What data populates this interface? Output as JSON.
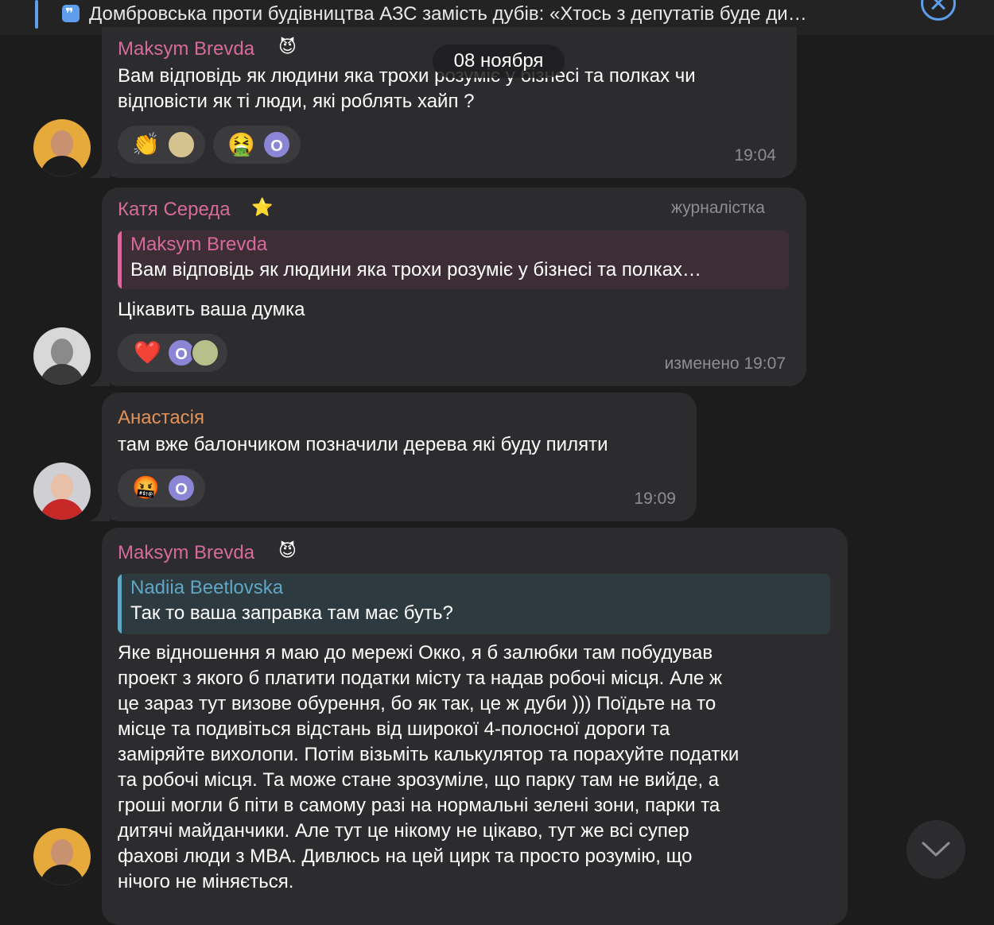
{
  "pinned": {
    "text": "Домбровська проти будівництва АЗС замість дубів: «Хтось з депутатів буде ди…"
  },
  "date_separator": "08 ноября",
  "messages": [
    {
      "sender": "Maksym Brevda",
      "sender_badge": "😈",
      "text_lines": [
        "Вам відповідь як людини яка трохи розуміє у бізнесі та полках чи",
        "відповісти як ті люди, які роблять хайп ?"
      ],
      "reactions": [
        "👏",
        "🤮"
      ],
      "reaction_initial": "О",
      "time": "19:04"
    },
    {
      "sender": "Катя Середа",
      "sender_badge": "⭐",
      "role": "журналістка",
      "reply_to": {
        "name": "Maksym Brevda",
        "text": "Вам відповідь як людини яка трохи розуміє у бізнесі та полках…"
      },
      "text": "Цікавить ваша думка",
      "reactions": [
        "❤️"
      ],
      "reaction_initial": "О",
      "time": "изменено 19:07"
    },
    {
      "sender": "Анастасія",
      "text": "там вже балончиком позначили дерева які буду пиляти",
      "reactions": [
        "🤬"
      ],
      "reaction_initial": "О",
      "time": "19:09"
    },
    {
      "sender": "Maksym Brevda",
      "sender_badge": "😈",
      "reply_to": {
        "name": "Nadiia Beetlovska",
        "text": "Так то ваша заправка там має буть?"
      },
      "text_lines": [
        "Яке відношення я маю до мережі Окко, я б залюбки там побудував",
        "проект з якого б платити податки місту та надав робочі місця. Але ж",
        "це зараз тут визове обурення, бо як так, це ж дуби ))) Поїдьте на то",
        "місце та подивіться відстань від широкої 4-полосної дороги та",
        "заміряйте вихолопи. Потім візьміть калькулятор та порахуйте податки",
        "та робочі місця. Та може стане зрозуміле, що парку там не вийде, а",
        "гроші могли б піти в самому разі на нормальні зелені зони, парки та",
        "дитячі майданчики. Але тут це нікому не цікаво, тут же всі супер",
        "фахові люди з MBA. Дивлюсь на цей цирк та просто розумію, що",
        "нічого не міняється."
      ]
    }
  ],
  "colors": {
    "background": "#1c1c1d",
    "bubble": "#2c2c2e",
    "maksym": "#d76a9c",
    "katya": "#d76a9c",
    "anastasia": "#e0925a",
    "nadiia": "#5fa7c4",
    "accent": "#5e9eec"
  }
}
